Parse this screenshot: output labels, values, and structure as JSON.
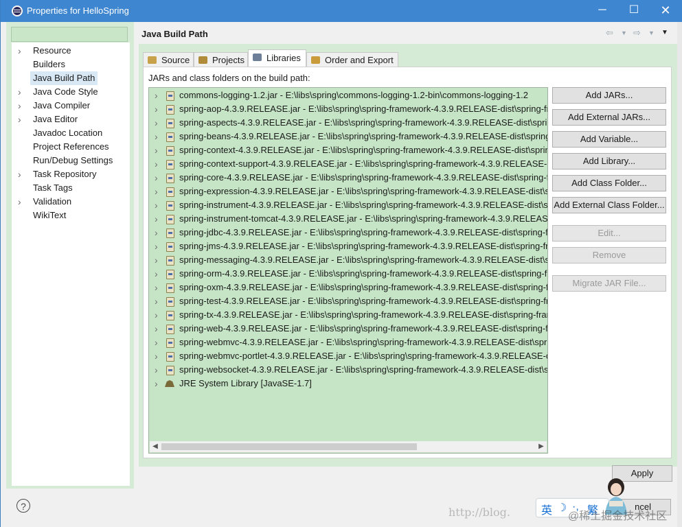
{
  "window": {
    "title": "Properties for HelloSpring",
    "controls": {
      "minimize": "─",
      "maximize": "☐",
      "close": "✕"
    }
  },
  "nav": {
    "filter_value": "",
    "items": [
      {
        "label": "Resource",
        "expandable": true
      },
      {
        "label": "Builders",
        "expandable": false
      },
      {
        "label": "Java Build Path",
        "expandable": false,
        "selected": true
      },
      {
        "label": "Java Code Style",
        "expandable": true
      },
      {
        "label": "Java Compiler",
        "expandable": true
      },
      {
        "label": "Java Editor",
        "expandable": true
      },
      {
        "label": "Javadoc Location",
        "expandable": false
      },
      {
        "label": "Project References",
        "expandable": false
      },
      {
        "label": "Run/Debug Settings",
        "expandable": false
      },
      {
        "label": "Task Repository",
        "expandable": true
      },
      {
        "label": "Task Tags",
        "expandable": false
      },
      {
        "label": "Validation",
        "expandable": true
      },
      {
        "label": "WikiText",
        "expandable": false
      }
    ]
  },
  "page": {
    "title": "Java Build Path",
    "back_icon": "⇦",
    "forward_icon": "⇨",
    "menu_icon": "▼"
  },
  "tabs": [
    {
      "label": "Source",
      "icon": "source-icon",
      "active": false
    },
    {
      "label": "Projects",
      "icon": "projects-icon",
      "active": false
    },
    {
      "label": "Libraries",
      "icon": "libraries-icon",
      "active": true
    },
    {
      "label": "Order and Export",
      "icon": "order-export-icon",
      "active": false
    }
  ],
  "libraries": {
    "heading": "JARs and class folders on the build path:",
    "entries": [
      {
        "text": "commons-logging-1.2.jar - E:\\libs\\spring\\commons-logging-1.2-bin\\commons-logging-1.2",
        "kind": "jar"
      },
      {
        "text": "spring-aop-4.3.9.RELEASE.jar - E:\\libs\\spring\\spring-framework-4.3.9.RELEASE-dist\\spring-fr",
        "kind": "jar"
      },
      {
        "text": "spring-aspects-4.3.9.RELEASE.jar - E:\\libs\\spring\\spring-framework-4.3.9.RELEASE-dist\\sprin",
        "kind": "jar"
      },
      {
        "text": "spring-beans-4.3.9.RELEASE.jar - E:\\libs\\spring\\spring-framework-4.3.9.RELEASE-dist\\spring-",
        "kind": "jar"
      },
      {
        "text": "spring-context-4.3.9.RELEASE.jar - E:\\libs\\spring\\spring-framework-4.3.9.RELEASE-dist\\spring",
        "kind": "jar"
      },
      {
        "text": "spring-context-support-4.3.9.RELEASE.jar - E:\\libs\\spring\\spring-framework-4.3.9.RELEASE-d",
        "kind": "jar"
      },
      {
        "text": "spring-core-4.3.9.RELEASE.jar - E:\\libs\\spring\\spring-framework-4.3.9.RELEASE-dist\\spring-fr",
        "kind": "jar"
      },
      {
        "text": "spring-expression-4.3.9.RELEASE.jar - E:\\libs\\spring\\spring-framework-4.3.9.RELEASE-dist\\sp",
        "kind": "jar"
      },
      {
        "text": "spring-instrument-4.3.9.RELEASE.jar - E:\\libs\\spring\\spring-framework-4.3.9.RELEASE-dist\\sp",
        "kind": "jar"
      },
      {
        "text": "spring-instrument-tomcat-4.3.9.RELEASE.jar - E:\\libs\\spring\\spring-framework-4.3.9.RELEASE",
        "kind": "jar"
      },
      {
        "text": "spring-jdbc-4.3.9.RELEASE.jar - E:\\libs\\spring\\spring-framework-4.3.9.RELEASE-dist\\spring-fr",
        "kind": "jar"
      },
      {
        "text": "spring-jms-4.3.9.RELEASE.jar - E:\\libs\\spring\\spring-framework-4.3.9.RELEASE-dist\\spring-fra",
        "kind": "jar"
      },
      {
        "text": "spring-messaging-4.3.9.RELEASE.jar - E:\\libs\\spring\\spring-framework-4.3.9.RELEASE-dist\\sp",
        "kind": "jar"
      },
      {
        "text": "spring-orm-4.3.9.RELEASE.jar - E:\\libs\\spring\\spring-framework-4.3.9.RELEASE-dist\\spring-fr",
        "kind": "jar"
      },
      {
        "text": "spring-oxm-4.3.9.RELEASE.jar - E:\\libs\\spring\\spring-framework-4.3.9.RELEASE-dist\\spring-fr",
        "kind": "jar"
      },
      {
        "text": "spring-test-4.3.9.RELEASE.jar - E:\\libs\\spring\\spring-framework-4.3.9.RELEASE-dist\\spring-fra",
        "kind": "jar"
      },
      {
        "text": "spring-tx-4.3.9.RELEASE.jar - E:\\libs\\spring\\spring-framework-4.3.9.RELEASE-dist\\spring-fran",
        "kind": "jar"
      },
      {
        "text": "spring-web-4.3.9.RELEASE.jar - E:\\libs\\spring\\spring-framework-4.3.9.RELEASE-dist\\spring-fr",
        "kind": "jar"
      },
      {
        "text": "spring-webmvc-4.3.9.RELEASE.jar - E:\\libs\\spring\\spring-framework-4.3.9.RELEASE-dist\\sprir",
        "kind": "jar"
      },
      {
        "text": "spring-webmvc-portlet-4.3.9.RELEASE.jar - E:\\libs\\spring\\spring-framework-4.3.9.RELEASE-d",
        "kind": "jar"
      },
      {
        "text": "spring-websocket-4.3.9.RELEASE.jar - E:\\libs\\spring\\spring-framework-4.3.9.RELEASE-dist\\sp",
        "kind": "jar"
      },
      {
        "text": "JRE System Library [JavaSE-1.7]",
        "kind": "jre"
      }
    ]
  },
  "buttons": [
    {
      "label": "Add JARs...",
      "enabled": true
    },
    {
      "label": "Add External JARs...",
      "enabled": true
    },
    {
      "label": "Add Variable...",
      "enabled": true
    },
    {
      "label": "Add Library...",
      "enabled": true
    },
    {
      "label": "Add Class Folder...",
      "enabled": true
    },
    {
      "label": "Add External Class Folder...",
      "enabled": true
    },
    {
      "label": "Edit...",
      "enabled": false
    },
    {
      "label": "Remove",
      "enabled": false
    },
    {
      "label": "Migrate JAR File...",
      "enabled": false
    }
  ],
  "footer": {
    "help": "?",
    "apply": "Apply",
    "cancel": "ncel",
    "ime_lang": "英",
    "ime_mode": "繁",
    "watermark_url": "http://blog.",
    "watermark_cn": "@稀土掘金技术社区"
  },
  "colors": {
    "titlebar": "#3f86d1",
    "panel_green": "#d6ebd6",
    "list_green": "#c6e5c6"
  }
}
